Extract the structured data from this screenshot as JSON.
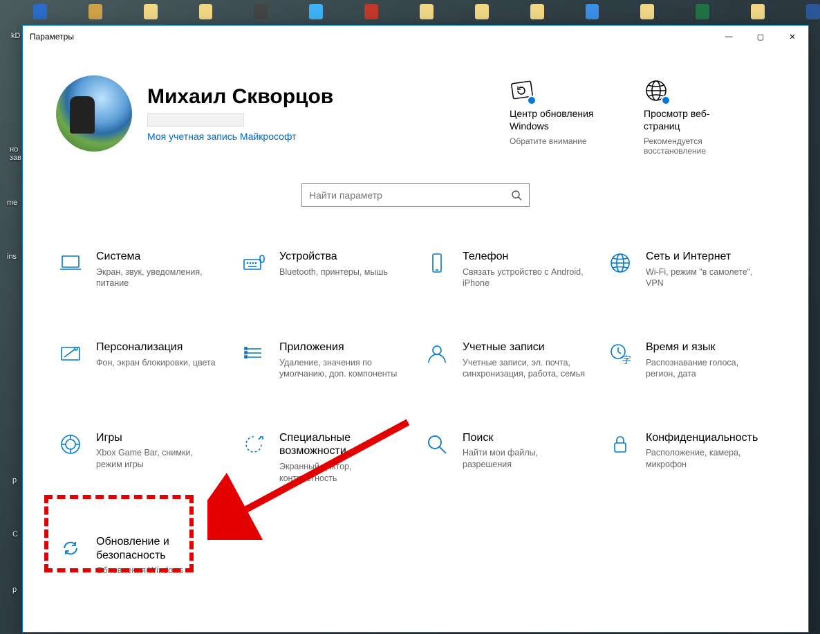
{
  "window": {
    "title": "Параметры"
  },
  "profile": {
    "name": "Михаил Скворцов",
    "ms_account_link": "Моя учетная запись Майкрософт"
  },
  "status_tiles": [
    {
      "title": "Центр обновления Windows",
      "sub": "Обратите внимание",
      "icon": "update"
    },
    {
      "title": "Просмотр веб-страниц",
      "sub": "Рекомендуется восстановление",
      "icon": "globe"
    }
  ],
  "search": {
    "placeholder": "Найти параметр"
  },
  "categories": [
    {
      "icon": "laptop",
      "title": "Система",
      "desc": "Экран, звук, уведомления, питание"
    },
    {
      "icon": "keyboard",
      "title": "Устройства",
      "desc": "Bluetooth, принтеры, мышь"
    },
    {
      "icon": "phone",
      "title": "Телефон",
      "desc": "Связать устройство с Android, iPhone"
    },
    {
      "icon": "globe2",
      "title": "Сеть и Интернет",
      "desc": "Wi-Fi, режим \"в самолете\", VPN"
    },
    {
      "icon": "personalize",
      "title": "Персонализация",
      "desc": "Фон, экран блокировки, цвета"
    },
    {
      "icon": "apps",
      "title": "Приложения",
      "desc": "Удаление, значения по умолчанию, доп. компоненты"
    },
    {
      "icon": "account",
      "title": "Учетные записи",
      "desc": "Учетные записи, эл. почта, синхронизация, работа, семья"
    },
    {
      "icon": "timelang",
      "title": "Время и язык",
      "desc": "Распознавание голоса, регион, дата"
    },
    {
      "icon": "gaming",
      "title": "Игры",
      "desc": "Xbox Game Bar, снимки, режим игры"
    },
    {
      "icon": "ease",
      "title": "Специальные возможности",
      "desc": "Экранный диктор, контрастность"
    },
    {
      "icon": "search",
      "title": "Поиск",
      "desc": "Найти мои файлы, разрешения"
    },
    {
      "icon": "privacy",
      "title": "Конфиденциальность",
      "desc": "Расположение, камера, микрофон"
    },
    {
      "icon": "update2",
      "title": "Обновление и безопасность",
      "desc": "Обновления Windows",
      "highlighted": true
    }
  ],
  "desktop_labels": [
    "kD",
    "но\nзав",
    "me",
    "ins",
    "p",
    "С",
    "p"
  ],
  "win_controls": {
    "min": "—",
    "max": "▢",
    "close": "✕"
  }
}
